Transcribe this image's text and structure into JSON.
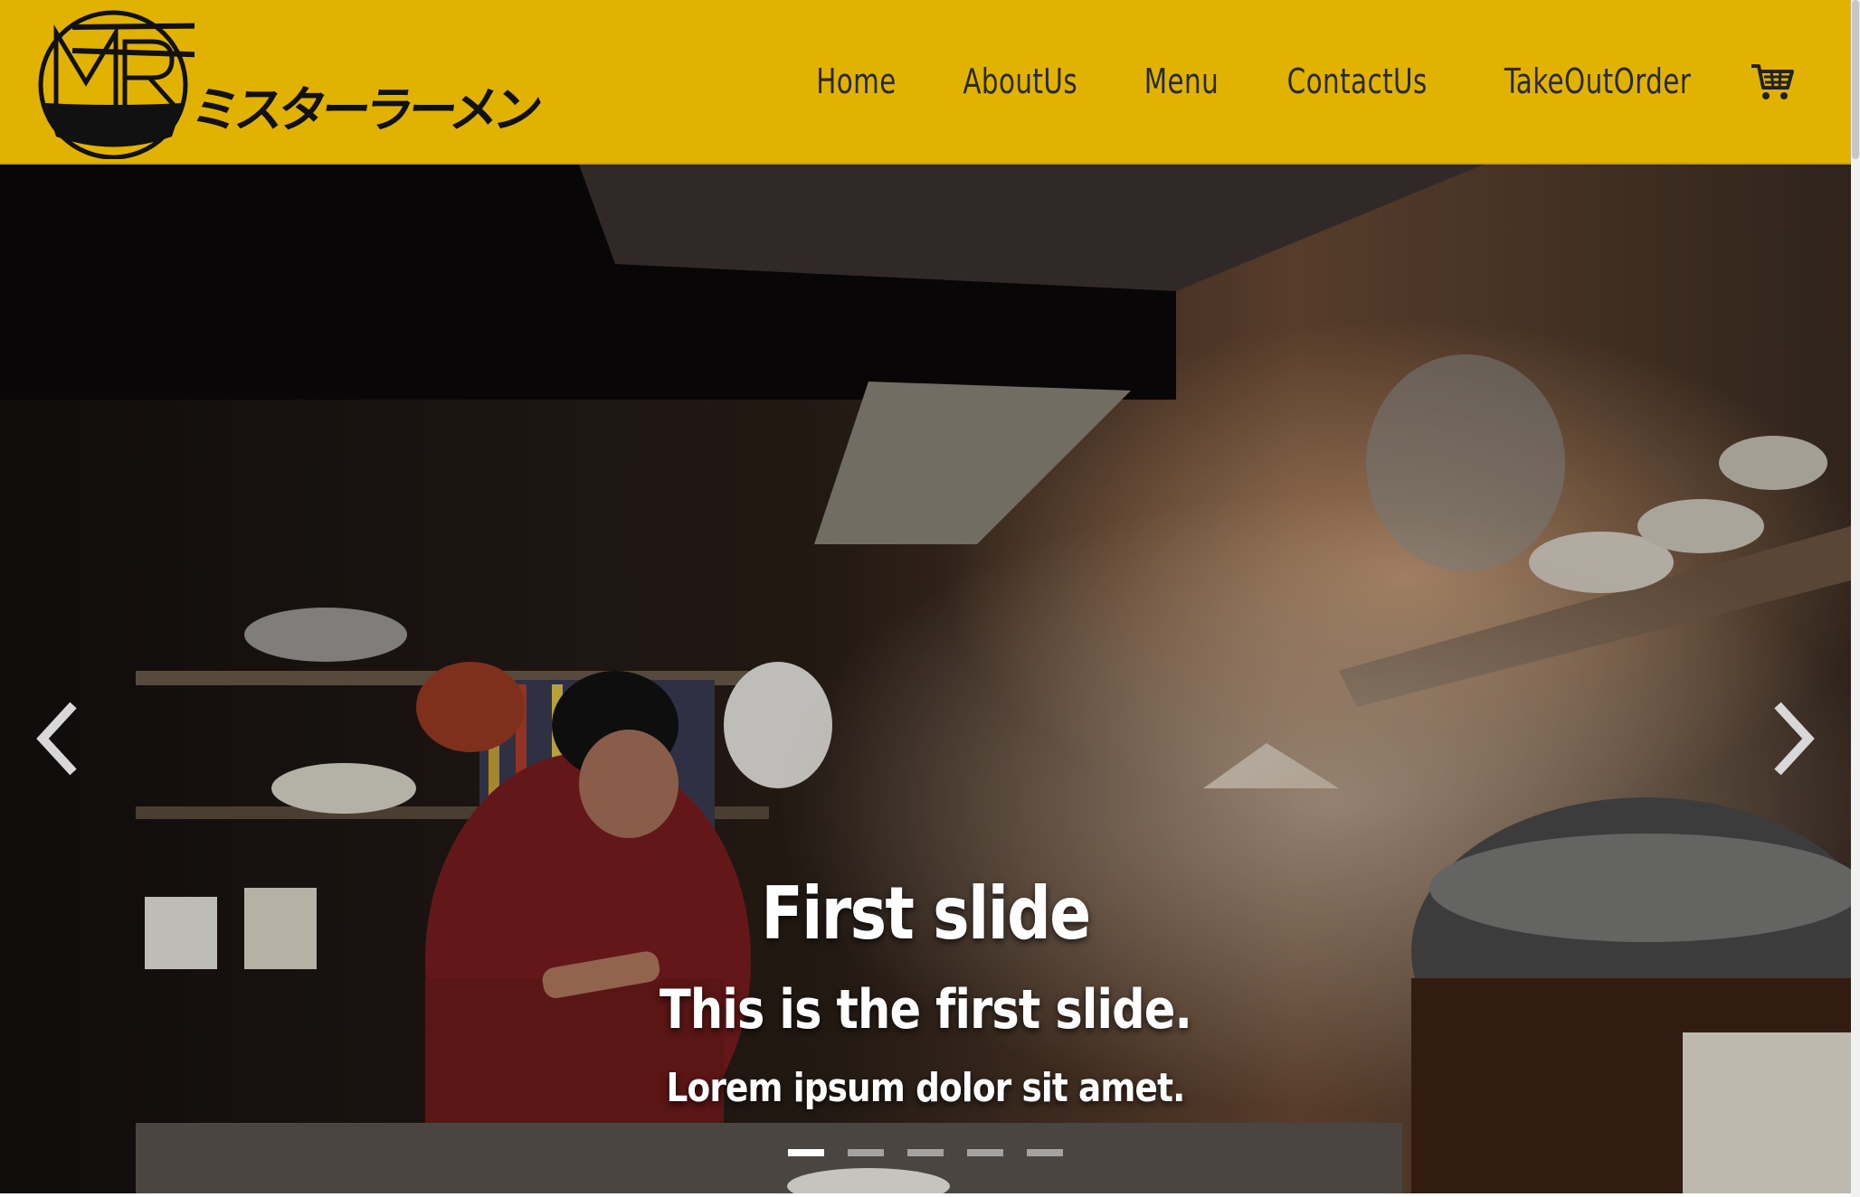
{
  "brand": {
    "logo_text": "MR RAMEN",
    "kana": "ミスターラーメン",
    "accent_color": "#e2b203"
  },
  "nav": {
    "items": [
      {
        "label": "Home"
      },
      {
        "label": "AboutUs"
      },
      {
        "label": "Menu"
      },
      {
        "label": "ContactUs"
      },
      {
        "label": "TakeOutOrder"
      }
    ],
    "cart_icon": "shopping-cart-icon"
  },
  "carousel": {
    "title": "First slide",
    "subtitle": "This is the first slide.",
    "text": "Lorem ipsum dolor sit amet.",
    "prev_icon": "chevron-left-icon",
    "next_icon": "chevron-right-icon",
    "slide_count": 5,
    "active_index": 0
  }
}
